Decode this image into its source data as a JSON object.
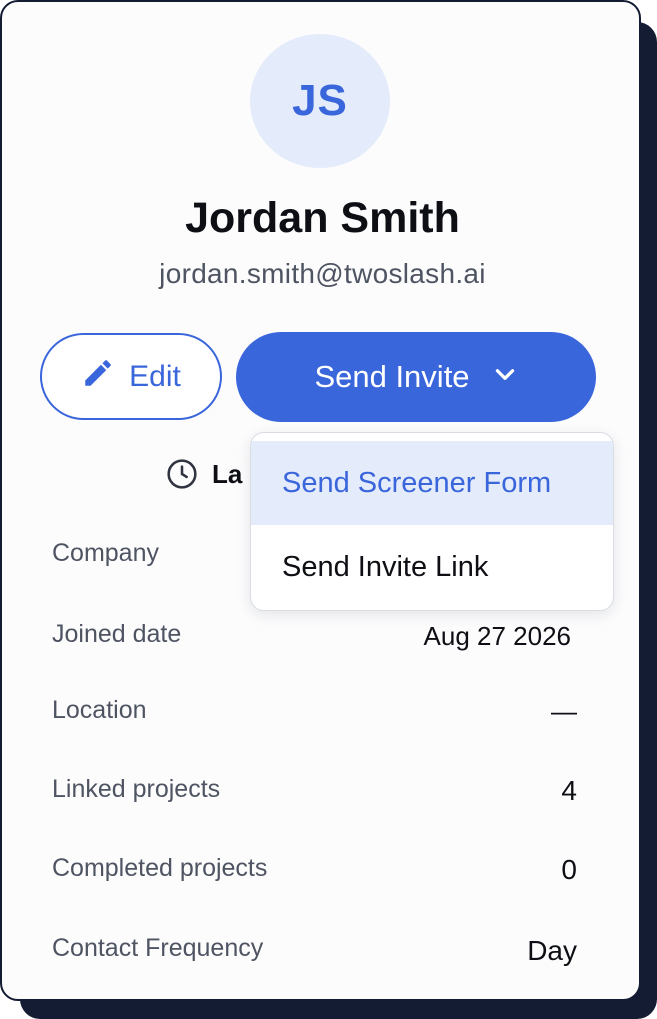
{
  "profile": {
    "initials": "JS",
    "name": "Jordan Smith",
    "email": "jordan.smith@twoslash.ai"
  },
  "actions": {
    "edit_label": "Edit",
    "send_invite_label": "Send Invite"
  },
  "last_active": {
    "label_visible": "La"
  },
  "details": [
    {
      "label": "Company",
      "value": ""
    },
    {
      "label": "Joined date",
      "value": "Aug 27 2026"
    },
    {
      "label": "Location",
      "value": "—"
    },
    {
      "label": "Linked projects",
      "value": "4"
    },
    {
      "label": "Completed projects",
      "value": "0"
    },
    {
      "label": "Contact Frequency",
      "value": "Day"
    }
  ],
  "invite_menu": {
    "items": [
      {
        "label": "Send Screener Form",
        "highlighted": true
      },
      {
        "label": "Send Invite Link",
        "highlighted": false
      }
    ]
  },
  "colors": {
    "accent": "#3a66dc",
    "avatar_bg": "#e4ebfa",
    "card_border": "#141c33",
    "text_primary": "#0d0f14",
    "text_secondary": "#4e5462"
  },
  "icons": {
    "edit": "pencil-icon",
    "send_invite": "chevron-down-icon",
    "last_active": "clock-icon"
  }
}
